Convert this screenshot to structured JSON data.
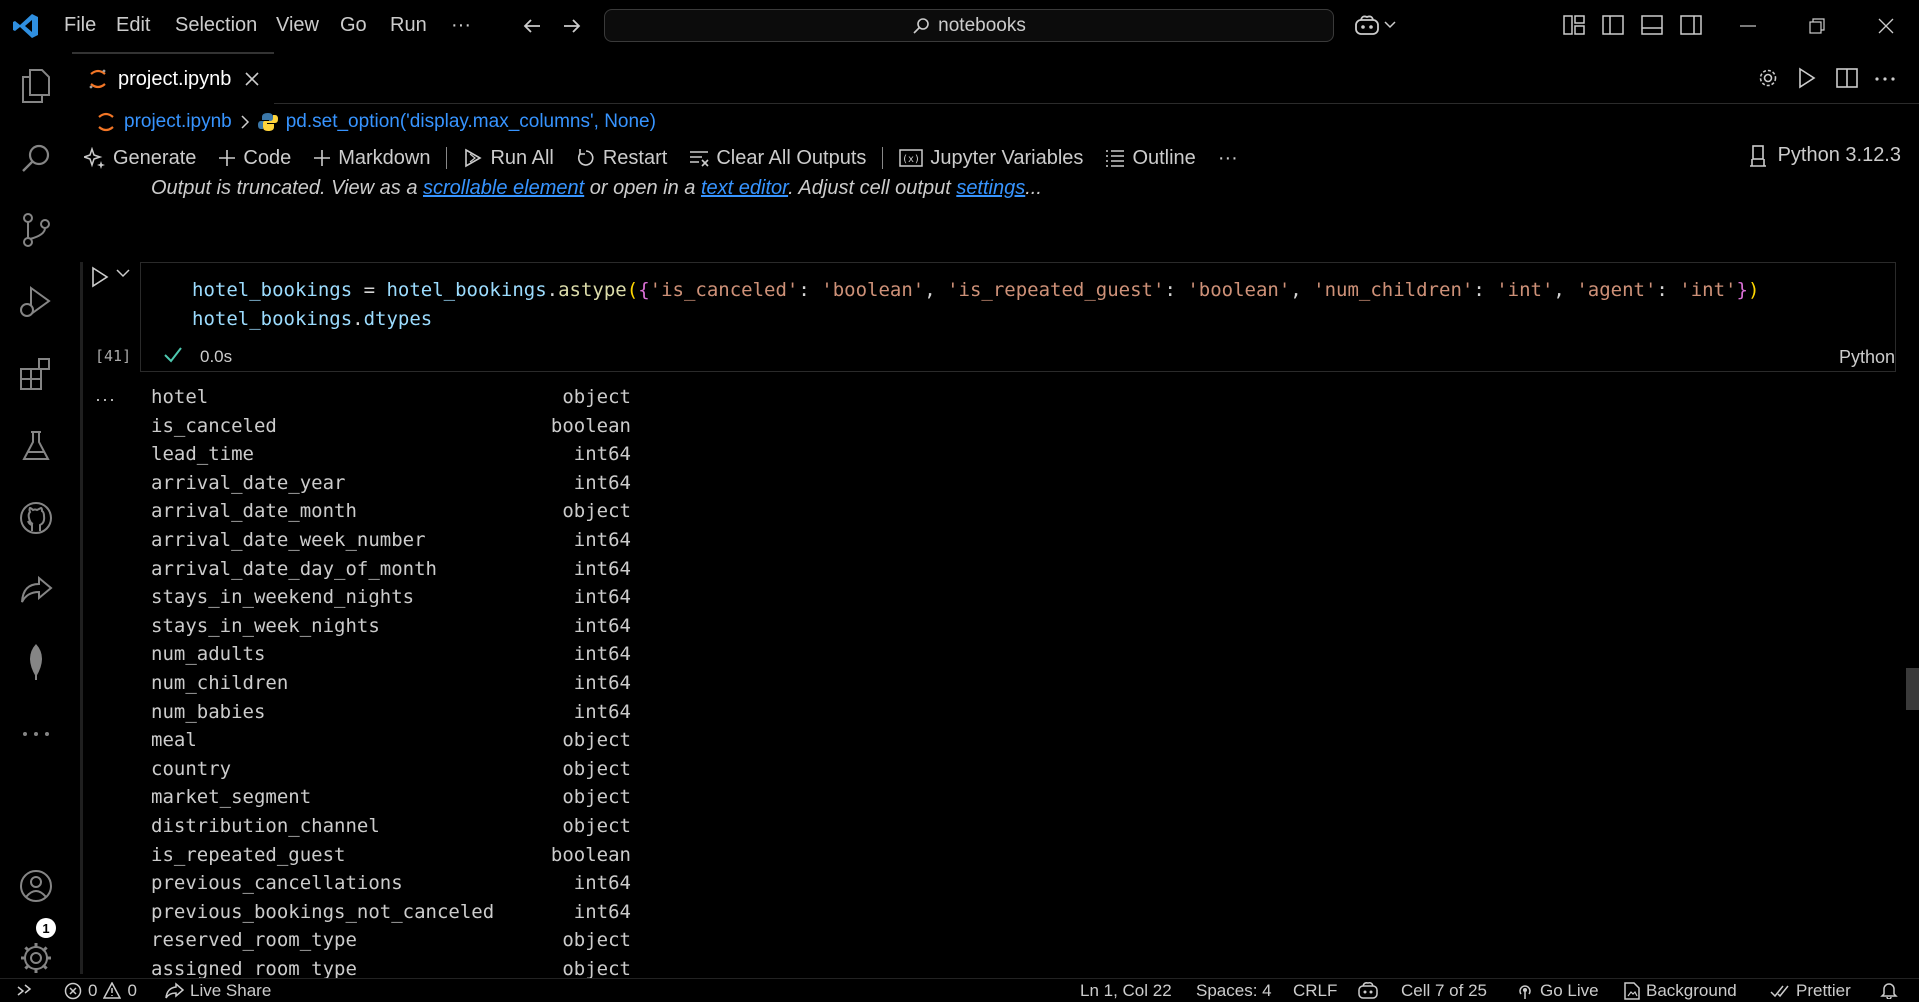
{
  "menu": [
    "File",
    "Edit",
    "Selection",
    "View",
    "Go",
    "Run",
    "···"
  ],
  "search": {
    "text": "notebooks"
  },
  "tab": {
    "label": "project.ipynb"
  },
  "breadcrumb": {
    "file": "project.ipynb",
    "symbol": "pd.set_option('display.max_columns', None)"
  },
  "toolbar": {
    "generate": "Generate",
    "code": "Code",
    "markdown": "Markdown",
    "run_all": "Run All",
    "restart": "Restart",
    "clear": "Clear All Outputs",
    "variables": "Jupyter Variables",
    "outline": "Outline",
    "more": "···",
    "kernel": "Python 3.12.3"
  },
  "truncated": {
    "prefix": "Output is truncated. View as a ",
    "link1": "scrollable element",
    "mid": " or open in a ",
    "link2": "text editor",
    "mid2": ". Adjust cell output ",
    "link3": "settings",
    "suffix": "..."
  },
  "cell": {
    "exec_count": "[41]",
    "time": "0.0s",
    "language": "Python",
    "line1": [
      {
        "t": "hotel_bookings",
        "c": "#9cdcfe"
      },
      {
        "t": " = ",
        "c": "#d4d4d4"
      },
      {
        "t": "hotel_bookings",
        "c": "#9cdcfe"
      },
      {
        "t": ".",
        "c": "#d4d4d4"
      },
      {
        "t": "astype",
        "c": "#dcdcaa"
      },
      {
        "t": "(",
        "c": "#ffd700"
      },
      {
        "t": "{",
        "c": "#da70d6"
      },
      {
        "t": "'is_canceled'",
        "c": "#ce9178"
      },
      {
        "t": ": ",
        "c": "#d4d4d4"
      },
      {
        "t": "'boolean'",
        "c": "#ce9178"
      },
      {
        "t": ", ",
        "c": "#d4d4d4"
      },
      {
        "t": "'is_repeated_guest'",
        "c": "#ce9178"
      },
      {
        "t": ": ",
        "c": "#d4d4d4"
      },
      {
        "t": "'boolean'",
        "c": "#ce9178"
      },
      {
        "t": ", ",
        "c": "#d4d4d4"
      },
      {
        "t": "'num_children'",
        "c": "#ce9178"
      },
      {
        "t": ": ",
        "c": "#d4d4d4"
      },
      {
        "t": "'int'",
        "c": "#ce9178"
      },
      {
        "t": ", ",
        "c": "#d4d4d4"
      },
      {
        "t": "'agent'",
        "c": "#ce9178"
      },
      {
        "t": ": ",
        "c": "#d4d4d4"
      },
      {
        "t": "'int'",
        "c": "#ce9178"
      },
      {
        "t": "}",
        "c": "#da70d6"
      },
      {
        "t": ")",
        "c": "#ffd700"
      }
    ],
    "line2": [
      {
        "t": "hotel_bookings",
        "c": "#9cdcfe"
      },
      {
        "t": ".",
        "c": "#d4d4d4"
      },
      {
        "t": "dtypes",
        "c": "#9cdcfe"
      }
    ]
  },
  "output": [
    {
      "name": "hotel",
      "type": "object"
    },
    {
      "name": "is_canceled",
      "type": "boolean"
    },
    {
      "name": "lead_time",
      "type": "int64"
    },
    {
      "name": "arrival_date_year",
      "type": "int64"
    },
    {
      "name": "arrival_date_month",
      "type": "object"
    },
    {
      "name": "arrival_date_week_number",
      "type": "int64"
    },
    {
      "name": "arrival_date_day_of_month",
      "type": "int64"
    },
    {
      "name": "stays_in_weekend_nights",
      "type": "int64"
    },
    {
      "name": "stays_in_week_nights",
      "type": "int64"
    },
    {
      "name": "num_adults",
      "type": "int64"
    },
    {
      "name": "num_children",
      "type": "int64"
    },
    {
      "name": "num_babies",
      "type": "int64"
    },
    {
      "name": "meal",
      "type": "object"
    },
    {
      "name": "country",
      "type": "object"
    },
    {
      "name": "market_segment",
      "type": "object"
    },
    {
      "name": "distribution_channel",
      "type": "object"
    },
    {
      "name": "is_repeated_guest",
      "type": "boolean"
    },
    {
      "name": "previous_cancellations",
      "type": "int64"
    },
    {
      "name": "previous_bookings_not_canceled",
      "type": "int64"
    },
    {
      "name": "reserved_room_type",
      "type": "object"
    },
    {
      "name": "assigned_room_type",
      "type": "object"
    }
  ],
  "accounts_badge": "1",
  "statusbar": {
    "errors": "0",
    "warnings": "0",
    "live_share": "Live Share",
    "position": "Ln 1, Col 22",
    "spaces": "Spaces: 4",
    "eol": "CRLF",
    "cell": "Cell 7 of 25",
    "go_live": "Go Live",
    "background": "Background",
    "prettier": "Prettier"
  }
}
